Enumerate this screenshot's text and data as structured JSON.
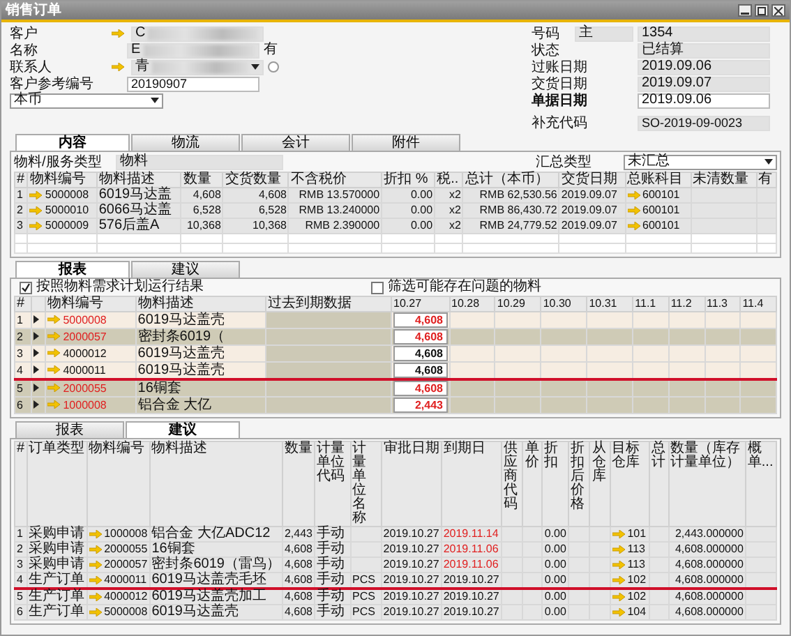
{
  "window": {
    "title": "销售订单"
  },
  "customer": {
    "label": "客户",
    "value": "C"
  },
  "name": {
    "label": "名称",
    "value": "E",
    "suffix": "有"
  },
  "contact": {
    "label": "联系人",
    "value": "青"
  },
  "reference": {
    "label": "客户参考编号",
    "value": "20190907"
  },
  "currency": {
    "value": "本币"
  },
  "fields": [
    {
      "label": "号码",
      "extra": "主",
      "value": "1354",
      "editable": false
    },
    {
      "label": "状态",
      "value": "已结算",
      "editable": false
    },
    {
      "label": "过账日期",
      "value": "2019.09.06",
      "editable": false
    },
    {
      "label": "交货日期",
      "value": "2019.09.07",
      "editable": false
    },
    {
      "label": "单据日期",
      "value": "2019.09.06",
      "editable": true
    }
  ],
  "supplement": {
    "label": "补充代码",
    "value": "SO-2019-09-0023"
  },
  "doc_tabs": [
    {
      "label": "内容",
      "selected": true
    },
    {
      "label": "物流",
      "selected": false
    },
    {
      "label": "会计",
      "selected": false
    },
    {
      "label": "附件",
      "selected": false
    }
  ],
  "item_type": {
    "label": "物料/服务类型",
    "value": "物料"
  },
  "summary": {
    "label": "汇总类型",
    "value": "未汇总"
  },
  "lines": {
    "columns": [
      "#",
      "物料编号",
      "物料描述",
      "数量",
      "交货数量",
      "不含税价",
      "折扣 %",
      "税..",
      "总计（本币）",
      "交货日期",
      "总账科目",
      "未清数量",
      "有"
    ],
    "rows": [
      {
        "no": "1",
        "code": "5000008",
        "desc": "6019马达盖",
        "qty": "4,608",
        "delivered": "4,608",
        "price": "RMB 13.570000",
        "discount": "0.00",
        "tax": "x2",
        "total": "RMB 62,530.56",
        "date": "2019.09.07",
        "account": "600101"
      },
      {
        "no": "2",
        "code": "5000010",
        "desc": "6066马达盖",
        "qty": "6,528",
        "delivered": "6,528",
        "price": "RMB 13.240000",
        "discount": "0.00",
        "tax": "x2",
        "total": "RMB 86,430.72",
        "date": "2019.09.07",
        "account": "600101"
      },
      {
        "no": "3",
        "code": "5000009",
        "desc": "576后盖A",
        "qty": "10,368",
        "delivered": "10,368",
        "price": "RMB 2.390000",
        "discount": "0.00",
        "tax": "x2",
        "total": "RMB 24,779.52",
        "date": "2019.09.07",
        "account": "600101"
      }
    ]
  },
  "report_tabs": [
    {
      "label": "报表",
      "selected": true
    },
    {
      "label": "建议",
      "selected": false
    }
  ],
  "report_options": [
    {
      "label": "按照物料需求计划运行结果",
      "checked": true
    },
    {
      "label": "筛选可能存在问题的物料",
      "checked": false
    }
  ],
  "report": {
    "columns": [
      "#",
      "物料编号",
      "物料描述",
      "过去到期数据",
      "10.27",
      "10.28",
      "10.29",
      "10.30",
      "10.31",
      "11.1",
      "11.2",
      "11.3",
      "11.4"
    ],
    "rows": [
      {
        "no": "1",
        "code": "5000008",
        "desc": "6019马达盖壳",
        "value": "4,608",
        "alert": true,
        "shaded": false,
        "underlined": false
      },
      {
        "no": "2",
        "code": "2000057",
        "desc": "密封条6019（",
        "value": "4,608",
        "alert": true,
        "shaded": true,
        "underlined": false
      },
      {
        "no": "3",
        "code": "4000012",
        "desc": "6019马达盖壳",
        "value": "4,608",
        "alert": false,
        "shaded": false,
        "underlined": false
      },
      {
        "no": "4",
        "code": "4000011",
        "desc": "6019马达盖壳",
        "value": "4,608",
        "alert": false,
        "shaded": false,
        "underlined": true
      },
      {
        "no": "5",
        "code": "2000055",
        "desc": "16铜套",
        "value": "4,608",
        "alert": true,
        "shaded": true,
        "underlined": false
      },
      {
        "no": "6",
        "code": "1000008",
        "desc": "铝合金 大亿",
        "value": "2,443",
        "alert": true,
        "shaded": true,
        "underlined": false
      }
    ]
  },
  "suggestion_tabs": [
    {
      "label": "报表",
      "selected": false
    },
    {
      "label": "建议",
      "selected": true
    }
  ],
  "suggestions": {
    "columns": [
      "#",
      "订单类型",
      "物料编号",
      "物料描述",
      "数量",
      "计量单位代码",
      "计量单位名称",
      "审批日期",
      "到期日",
      "供应商代码",
      "单价",
      "折扣",
      "折扣后价格",
      "从仓库",
      "目标仓库",
      "总计",
      "数量（库存计量单位）",
      "概单..."
    ],
    "rows": [
      {
        "no": "1",
        "type": "采购申请",
        "code": "1000008",
        "desc": "铝合金 大亿ADC12",
        "qty": "2,443",
        "mode": "手动",
        "approved": "2019.10.27",
        "due": "2019.11.14",
        "discount": "0.00",
        "warehouse": "101",
        "stock_qty": "2,443.000000",
        "overdue": true,
        "underlined": false
      },
      {
        "no": "2",
        "type": "采购申请",
        "code": "2000055",
        "desc": "16铜套",
        "qty": "4,608",
        "mode": "手动",
        "approved": "2019.10.27",
        "due": "2019.11.06",
        "discount": "0.00",
        "warehouse": "113",
        "stock_qty": "4,608.000000",
        "overdue": true,
        "underlined": false
      },
      {
        "no": "3",
        "type": "采购申请",
        "code": "2000057",
        "desc": "密封条6019（雷鸟）",
        "qty": "4,608",
        "mode": "手动",
        "approved": "2019.10.27",
        "due": "2019.11.06",
        "discount": "0.00",
        "warehouse": "113",
        "stock_qty": "4,608.000000",
        "overdue": true,
        "underlined": false
      },
      {
        "no": "4",
        "type": "生产订单",
        "code": "4000011",
        "desc": "6019马达盖壳毛坯",
        "qty": "4,608",
        "mode": "手动",
        "uom": "PCS",
        "approved": "2019.10.27",
        "due": "2019.10.27",
        "discount": "0.00",
        "warehouse": "102",
        "stock_qty": "4,608.000000",
        "overdue": false,
        "underlined": true
      },
      {
        "no": "5",
        "type": "生产订单",
        "code": "4000012",
        "desc": "6019马达盖壳加工",
        "qty": "4,608",
        "mode": "手动",
        "uom": "PCS",
        "approved": "2019.10.27",
        "due": "2019.10.27",
        "discount": "0.00",
        "warehouse": "102",
        "stock_qty": "4,608.000000",
        "overdue": false,
        "underlined": false
      },
      {
        "no": "6",
        "type": "生产订单",
        "code": "5000008",
        "desc": "6019马达盖壳",
        "qty": "4,608",
        "mode": "手动",
        "uom": "PCS",
        "approved": "2019.10.27",
        "due": "2019.10.27",
        "discount": "0.00",
        "warehouse": "104",
        "stock_qty": "4,608.000000",
        "overdue": false,
        "underlined": false
      }
    ]
  }
}
